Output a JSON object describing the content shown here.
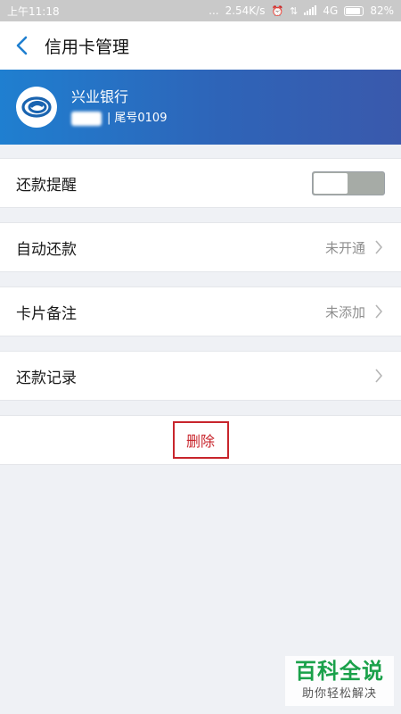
{
  "status_bar": {
    "time": "上午11:18",
    "dots": "...",
    "speed": "2.54K/s",
    "network": "4G",
    "battery": "82%"
  },
  "nav": {
    "title": "信用卡管理"
  },
  "card": {
    "bank_name": "兴业银行",
    "separator": "|",
    "tail_number": "尾号0109"
  },
  "settings": {
    "repay_reminder": {
      "label": "还款提醒",
      "enabled": false
    },
    "auto_repay": {
      "label": "自动还款",
      "value": "未开通"
    },
    "card_note": {
      "label": "卡片备注",
      "value": "未添加"
    },
    "repay_record": {
      "label": "还款记录"
    }
  },
  "actions": {
    "delete_label": "删除"
  },
  "watermark": {
    "title": "百科全说",
    "subtitle": "助你轻松解决"
  },
  "colors": {
    "accent_blue": "#1f7fd0",
    "banner_end": "#3a59ac",
    "delete_red": "#c8252c",
    "watermark_green": "#1aa14a"
  },
  "icons": {
    "back": "chevron-left-icon",
    "bank_logo": "cib-bank-logo",
    "row_arrow": "chevron-right-icon"
  }
}
